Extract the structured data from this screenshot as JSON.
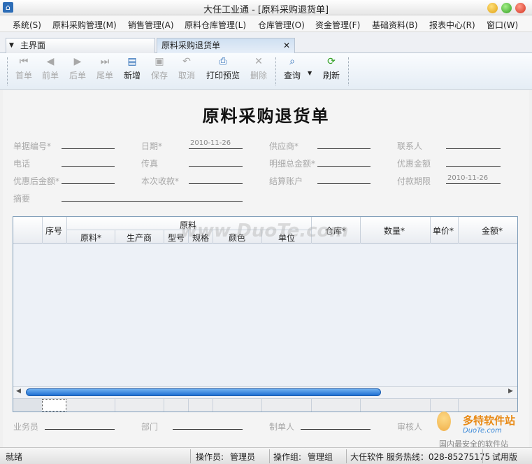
{
  "window": {
    "title": "大任工业通 - [原料采购退货单]"
  },
  "menu": [
    "系统(S)",
    "原料采购管理(M)",
    "销售管理(A)",
    "原料仓库管理(L)",
    "仓库管理(O)",
    "资金管理(F)",
    "基础资料(B)",
    "报表中心(R)",
    "窗口(W)"
  ],
  "tabs": {
    "home": "主界面",
    "active": "原料采购退货单",
    "close": "✕"
  },
  "toolbar": {
    "first": "首单",
    "prev": "前单",
    "next": "后单",
    "last": "尾单",
    "new": "新增",
    "save": "保存",
    "cancel": "取消",
    "print": "打印预览",
    "delete": "删除",
    "query": "查询",
    "refresh": "刷新"
  },
  "form": {
    "title": "原料采购退货单",
    "doc_no": "单据编号*",
    "date": "日期*",
    "date_value": "2010-11-26",
    "supplier": "供应商*",
    "contact": "联系人",
    "phone": "电话",
    "fax": "传真",
    "detail_total": "明细总金额*",
    "discount": "优惠金额",
    "after_discount": "优惠后金额*",
    "this_receipt": "本次收款*",
    "account": "结算账户",
    "pay_deadline": "付款期限",
    "deadline_value": "2010-11-26",
    "summary": "摘要"
  },
  "grid": {
    "seq": "序号",
    "material_group": "原料",
    "material": "原料*",
    "maker": "生产商",
    "model": "型号",
    "spec": "规格",
    "color": "颜色",
    "unit": "单位",
    "warehouse": "仓库*",
    "quantity": "数量*",
    "price": "单价*",
    "amount": "金额*"
  },
  "footer": {
    "salesman": "业务员",
    "dept": "部门",
    "maker": "制单人",
    "auditor": "审核人"
  },
  "status": {
    "ready": "就绪",
    "operator_label": "操作员:",
    "operator": "管理员",
    "group_label": "操作组:",
    "group": "管理组",
    "hotline": "大任软件 服务热线：028-85275175",
    "edition": "试用版"
  },
  "watermark": {
    "center": "www.DuoTe.com",
    "brand": "多特软件站",
    "brand_en": "DuoTe.com",
    "slogan": "国内最安全的软件站"
  }
}
